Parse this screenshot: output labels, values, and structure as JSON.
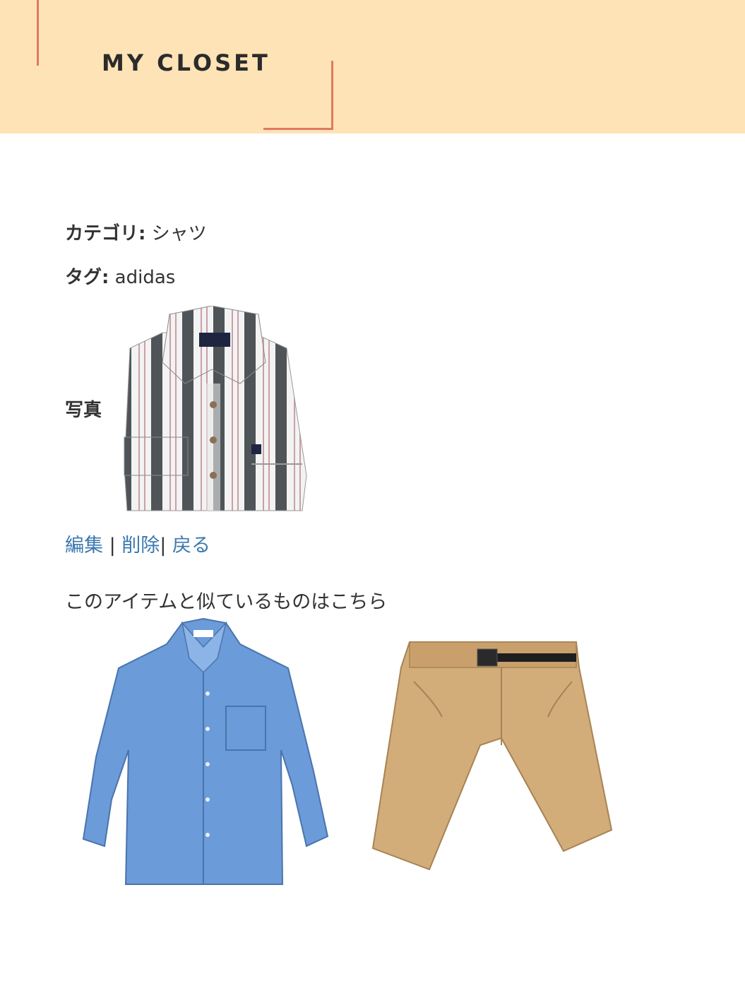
{
  "header": {
    "logo_text": "MY CLOSET",
    "accent_color": "#e07a5f",
    "background": "#fee3b6"
  },
  "detail": {
    "category_label": "カテゴリ:",
    "category_value": "シャツ",
    "tag_label": "タグ:",
    "tag_value": "adidas",
    "photo_label": "写真"
  },
  "actions": {
    "edit": "編集",
    "sep1": " | ",
    "delete": "削除",
    "sep2": "| ",
    "back": "戻る",
    "link_color": "#3b78ad"
  },
  "similar": {
    "title": "このアイテムと似ているものはこちら",
    "items": [
      {
        "icon": "blue-shirt-icon"
      },
      {
        "icon": "khaki-shorts-icon"
      }
    ]
  }
}
